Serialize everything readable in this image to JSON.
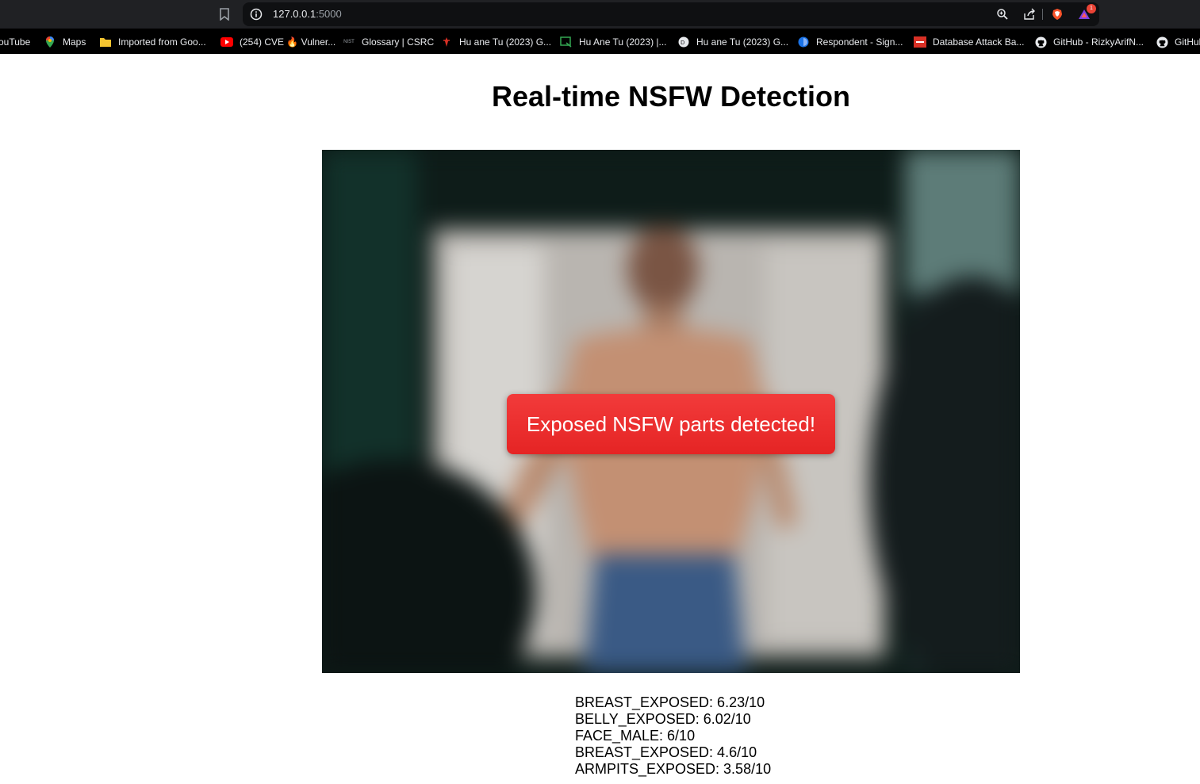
{
  "browser": {
    "url_host": "127.0.0.1",
    "url_port": ":5000",
    "notification_count": "1"
  },
  "bookmarks": [
    {
      "label": "ouTube",
      "icon": "youtube-icon"
    },
    {
      "label": "Maps",
      "icon": "maps-pin-icon"
    },
    {
      "label": "Imported from Goo...",
      "icon": "folder-icon"
    },
    {
      "label": "(254) CVE 🔥 Vulner...",
      "icon": "youtube-icon"
    },
    {
      "label": "Glossary | CSRC",
      "icon": "nist-icon"
    },
    {
      "label": "Hu ane Tu (2023) G...",
      "icon": "site-icon"
    },
    {
      "label": "Hu Ane Tu (2023) |...",
      "icon": "site-icon"
    },
    {
      "label": "Hu ane Tu (2023) G...",
      "icon": "site-icon"
    },
    {
      "label": "Respondent - Sign...",
      "icon": "respondent-icon"
    },
    {
      "label": "Database Attack Ba...",
      "icon": "site-icon"
    },
    {
      "label": "GitHub - RizkyArifN...",
      "icon": "github-icon"
    },
    {
      "label": "GitHul",
      "icon": "github-icon"
    }
  ],
  "page": {
    "title": "Real-time NSFW Detection",
    "alert_text": "Exposed NSFW parts detected!"
  },
  "results": [
    "BREAST_EXPOSED: 6.23/10",
    "BELLY_EXPOSED: 6.02/10",
    "FACE_MALE: 6/10",
    "BREAST_EXPOSED: 4.6/10",
    "ARMPITS_EXPOSED: 3.58/10"
  ],
  "colors": {
    "alert_background": "#e52424",
    "chrome_background": "#202124",
    "bookmarks_background": "#000000"
  }
}
